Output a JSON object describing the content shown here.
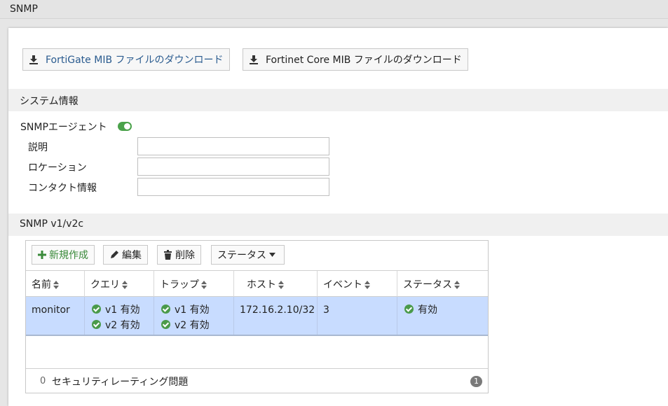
{
  "topbar": {
    "title": "SNMP"
  },
  "downloads": {
    "fortigate_mib": "FortiGate MIB ファイルのダウンロード",
    "fortinet_core_mib": "Fortinet Core MIB ファイルのダウンロード"
  },
  "system_info": {
    "header": "システム情報",
    "agent_label": "SNMPエージェント",
    "agent_enabled": true,
    "fields": [
      {
        "label": "説明",
        "value": ""
      },
      {
        "label": "ロケーション",
        "value": ""
      },
      {
        "label": "コンタクト情報",
        "value": ""
      }
    ]
  },
  "snmp_v1v2c": {
    "header": "SNMP v1/v2c",
    "toolbar": {
      "new_label": "新規作成",
      "edit_label": "編集",
      "delete_label": "削除",
      "status_label": "ステータス"
    },
    "columns": [
      "名前",
      "クエリ",
      "トラップ",
      "ホスト",
      "イベント",
      "ステータス"
    ],
    "rows": [
      {
        "name": "monitor",
        "query": [
          "v1 有効",
          "v2 有効"
        ],
        "trap": [
          "v1 有効",
          "v2 有効"
        ],
        "host": "172.16.2.10/32",
        "events": "3",
        "status": "有効"
      }
    ],
    "footer": {
      "count": "0",
      "text": "セキュリティレーティング問題",
      "badge": "1"
    }
  },
  "colors": {
    "green": "#4a9a4a",
    "selected_row": "#c8dcff",
    "link_blue": "#2a5b8f"
  }
}
